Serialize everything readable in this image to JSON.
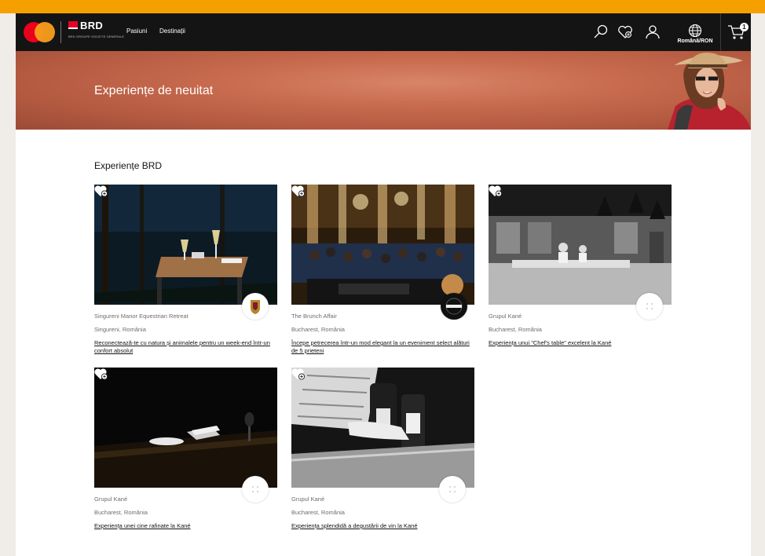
{
  "header": {
    "brand": "BRD",
    "brand_tagline": "BRD GROUPE SOCIETE GENERALE",
    "nav": [
      {
        "label": "Pasiuni"
      },
      {
        "label": "Destinații"
      }
    ],
    "language_label": "Română/RON",
    "cart_count": "1",
    "icons": [
      "search-icon",
      "heart-add-icon",
      "user-icon",
      "globe-icon",
      "cart-icon"
    ]
  },
  "hero": {
    "title": "Experiențe de neuitat"
  },
  "section": {
    "title": "Experiențe BRD"
  },
  "cards": [
    {
      "organizer": "Singureni Manor Equestrian Retreat",
      "location": "Singureni, România",
      "title": "Reconectează-te cu natura și animalele pentru un week-end într-un confort absolut"
    },
    {
      "organizer": "The Brunch Affair",
      "location": "Bucharest, România",
      "title": "Începe petrecerea într-un mod elegant la un eveniment select alături de 5 prieteni"
    },
    {
      "organizer": "Grupul Kané",
      "location": "Bucharest, România",
      "title": "Experiența unui \"Chef's table\" excelent la Kané"
    },
    {
      "organizer": "Grupul Kané",
      "location": "Bucharest, România",
      "title": "Experiența unei cine rafinate la Kané"
    },
    {
      "organizer": "Grupul Kané",
      "location": "Bucharest, România",
      "title": "Experiența splendidă a degustării de vin la Kané"
    }
  ],
  "colors": {
    "top_strip": "#f5a000",
    "navbar": "#141414",
    "hero": "#c86b4f",
    "mastercard_red": "#eb001b",
    "mastercard_orange": "#f79e1b",
    "brd_red": "#e60028"
  }
}
